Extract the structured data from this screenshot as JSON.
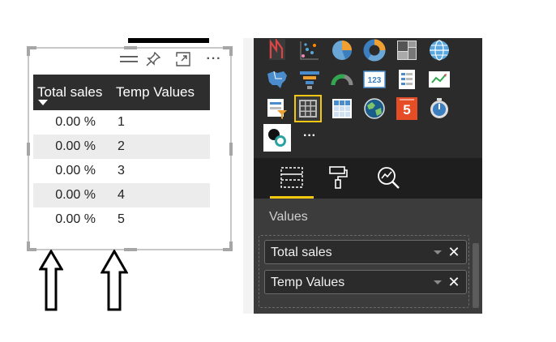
{
  "visual": {
    "header_icons": [
      "drag-handle-icon",
      "pin-icon",
      "focus-mode-icon",
      "more-options-icon"
    ],
    "more_label": "···",
    "columns": [
      "Total sales",
      "Temp Values"
    ],
    "rows": [
      [
        "0.00 %",
        "1"
      ],
      [
        "0.00 %",
        "2"
      ],
      [
        "0.00 %",
        "3"
      ],
      [
        "0.00 %",
        "4"
      ],
      [
        "0.00 %",
        "5"
      ]
    ]
  },
  "visualizations": {
    "icons": [
      "ribbon-chart-icon",
      "scatter-chart-icon",
      "pie-chart-icon",
      "donut-chart-icon",
      "treemap-icon",
      "globe-map-icon",
      "filled-map-icon",
      "funnel-chart-icon",
      "gauge-icon",
      "card-icon",
      "multi-row-card-icon",
      "kpi-icon",
      "slicer-icon",
      "table-icon",
      "matrix-icon",
      "arcgis-map-icon",
      "html5-visual-icon",
      "custom-visual-icon",
      "custom-visual-2-icon"
    ],
    "more_label": "···",
    "tabs": [
      "fields-tab-icon",
      "format-tab-icon",
      "analytics-tab-icon"
    ],
    "values_label": "Values",
    "fields": [
      "Total sales",
      "Temp Values"
    ]
  },
  "colors": {
    "panel_bg": "#2b2b2b",
    "tab_accent": "#f2c811",
    "table_header_bg": "#2e2e2e",
    "html5_orange": "#e44d26"
  }
}
